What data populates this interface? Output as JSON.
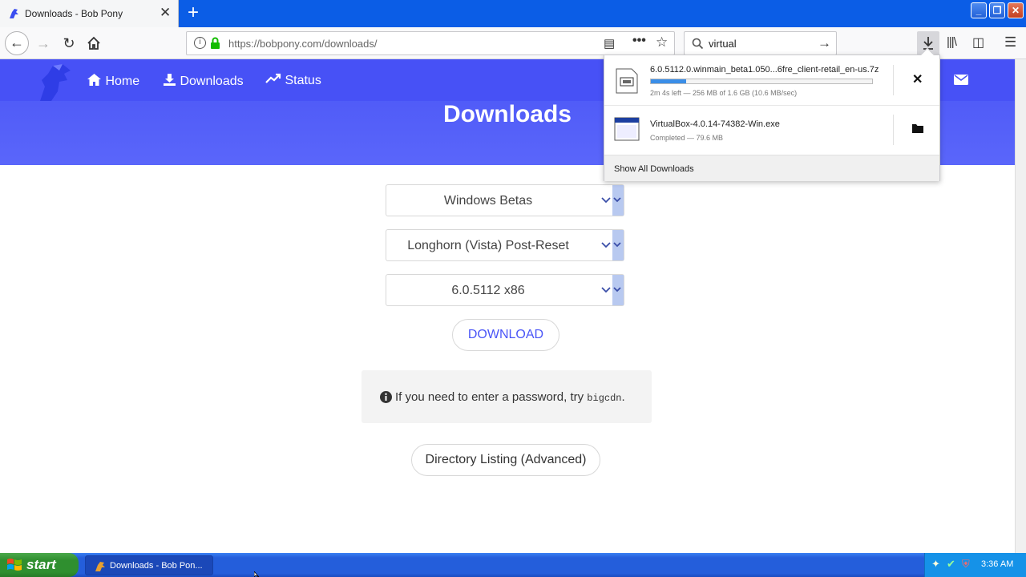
{
  "browser": {
    "tab_title": "Downloads - Bob Pony",
    "tab_close": "✕",
    "new_tab": "+",
    "url": "https://bobpony.com/downloads/",
    "search_value": "virtual"
  },
  "site": {
    "nav": [
      {
        "label": "Home",
        "icon": "home-icon"
      },
      {
        "label": "Downloads",
        "icon": "download-icon"
      },
      {
        "label": "Status",
        "icon": "trending-icon"
      }
    ],
    "page_title": "Downloads"
  },
  "form": {
    "category": "Windows Betas",
    "series": "Longhorn (Vista) Post-Reset",
    "build": "6.0.5112 x86",
    "download_label": "DOWNLOAD",
    "info_text": "If you need to enter a password, try ",
    "info_code": "bigcdn",
    "info_suffix": ".",
    "directory_label": "Directory Listing (Advanced)"
  },
  "downloads_panel": {
    "items": [
      {
        "name": "6.0.5112.0.winmain_beta1.050...6fre_client-retail_en-us.7z",
        "status": "2m 4s left — 256 MB of 1.6 GB (10.6 MB/sec)",
        "progress": 0.16
      },
      {
        "name": "VirtualBox-4.0.14-74382-Win.exe",
        "status": "Completed — 79.6 MB"
      }
    ],
    "show_all": "Show All Downloads"
  },
  "taskbar": {
    "start_label": "start",
    "task_label": "Downloads - Bob Pon...",
    "clock": "3:36 AM"
  },
  "colors": {
    "site_header": "#4a55f7",
    "taskbar": "#245edb",
    "start": "#2f8f2f",
    "progress": "#3a8ee8"
  }
}
